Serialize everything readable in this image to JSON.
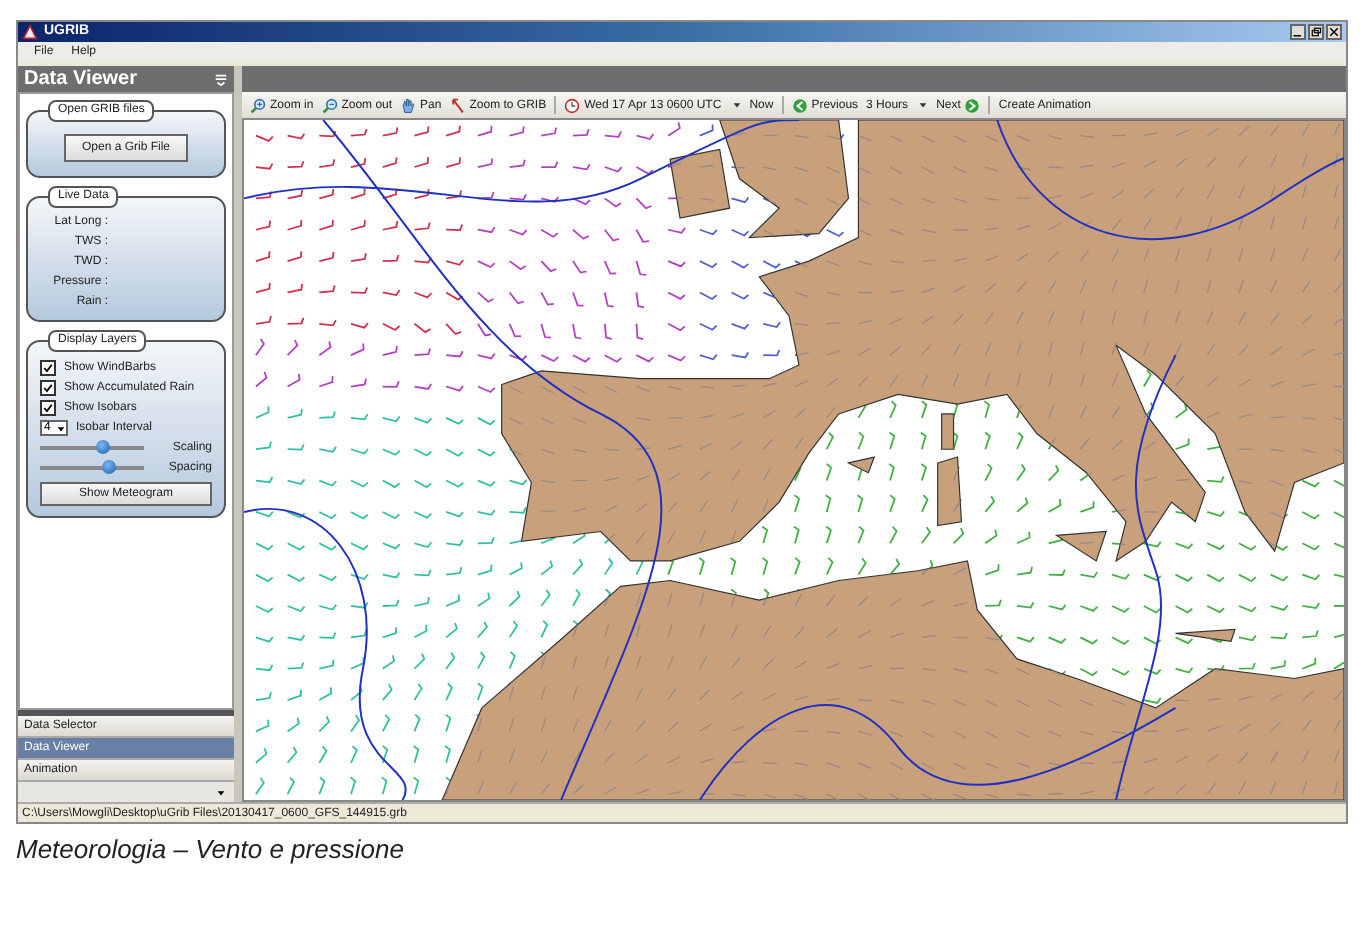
{
  "window": {
    "title": "UGRIB"
  },
  "menu": [
    "File",
    "Help"
  ],
  "sidebar": {
    "title": "Data Viewer",
    "open_grib": {
      "title": "Open GRIB files",
      "button": "Open a Grib File"
    },
    "live_data": {
      "title": "Live Data",
      "fields": [
        "Lat Long :",
        "TWS :",
        "TWD :",
        "Pressure :",
        "Rain :"
      ]
    },
    "display_layers": {
      "title": "Display Layers",
      "checkboxes": [
        {
          "label": "Show WindBarbs",
          "checked": true
        },
        {
          "label": "Show Accumulated Rain",
          "checked": true
        },
        {
          "label": "Show Isobars",
          "checked": true
        }
      ],
      "isobar_interval": {
        "value": "4",
        "label": "Isobar Interval"
      },
      "sliders": [
        {
          "label": "Scaling",
          "level": 0.62
        },
        {
          "label": "Spacing",
          "level": 0.68
        }
      ],
      "button": "Show Meteogram"
    },
    "nav": [
      {
        "label": "Data Selector",
        "selected": false
      },
      {
        "label": "Data Viewer",
        "selected": true
      },
      {
        "label": "Animation",
        "selected": false
      }
    ]
  },
  "toolbar": [
    {
      "kind": "zoomin",
      "label": "Zoom in"
    },
    {
      "kind": "zoomout",
      "label": "Zoom out"
    },
    {
      "kind": "pan",
      "label": "Pan"
    },
    {
      "kind": "fit",
      "label": "Zoom to GRIB"
    },
    {
      "kind": "date",
      "label": "Wed 17 Apr 13 0600 UTC"
    },
    {
      "kind": "link",
      "label": "Now"
    },
    {
      "kind": "prev",
      "label": "Previous"
    },
    {
      "kind": "spinner",
      "label": "3 Hours"
    },
    {
      "kind": "next",
      "label": "Next"
    },
    {
      "kind": "action",
      "label": "Create Animation"
    }
  ],
  "status_bar": "C:\\Users\\Mowgli\\Desktop\\uGrib Files\\20130417_0600_GFS_144915.grb",
  "caption": "Meteorologia – Vento e pressione"
}
